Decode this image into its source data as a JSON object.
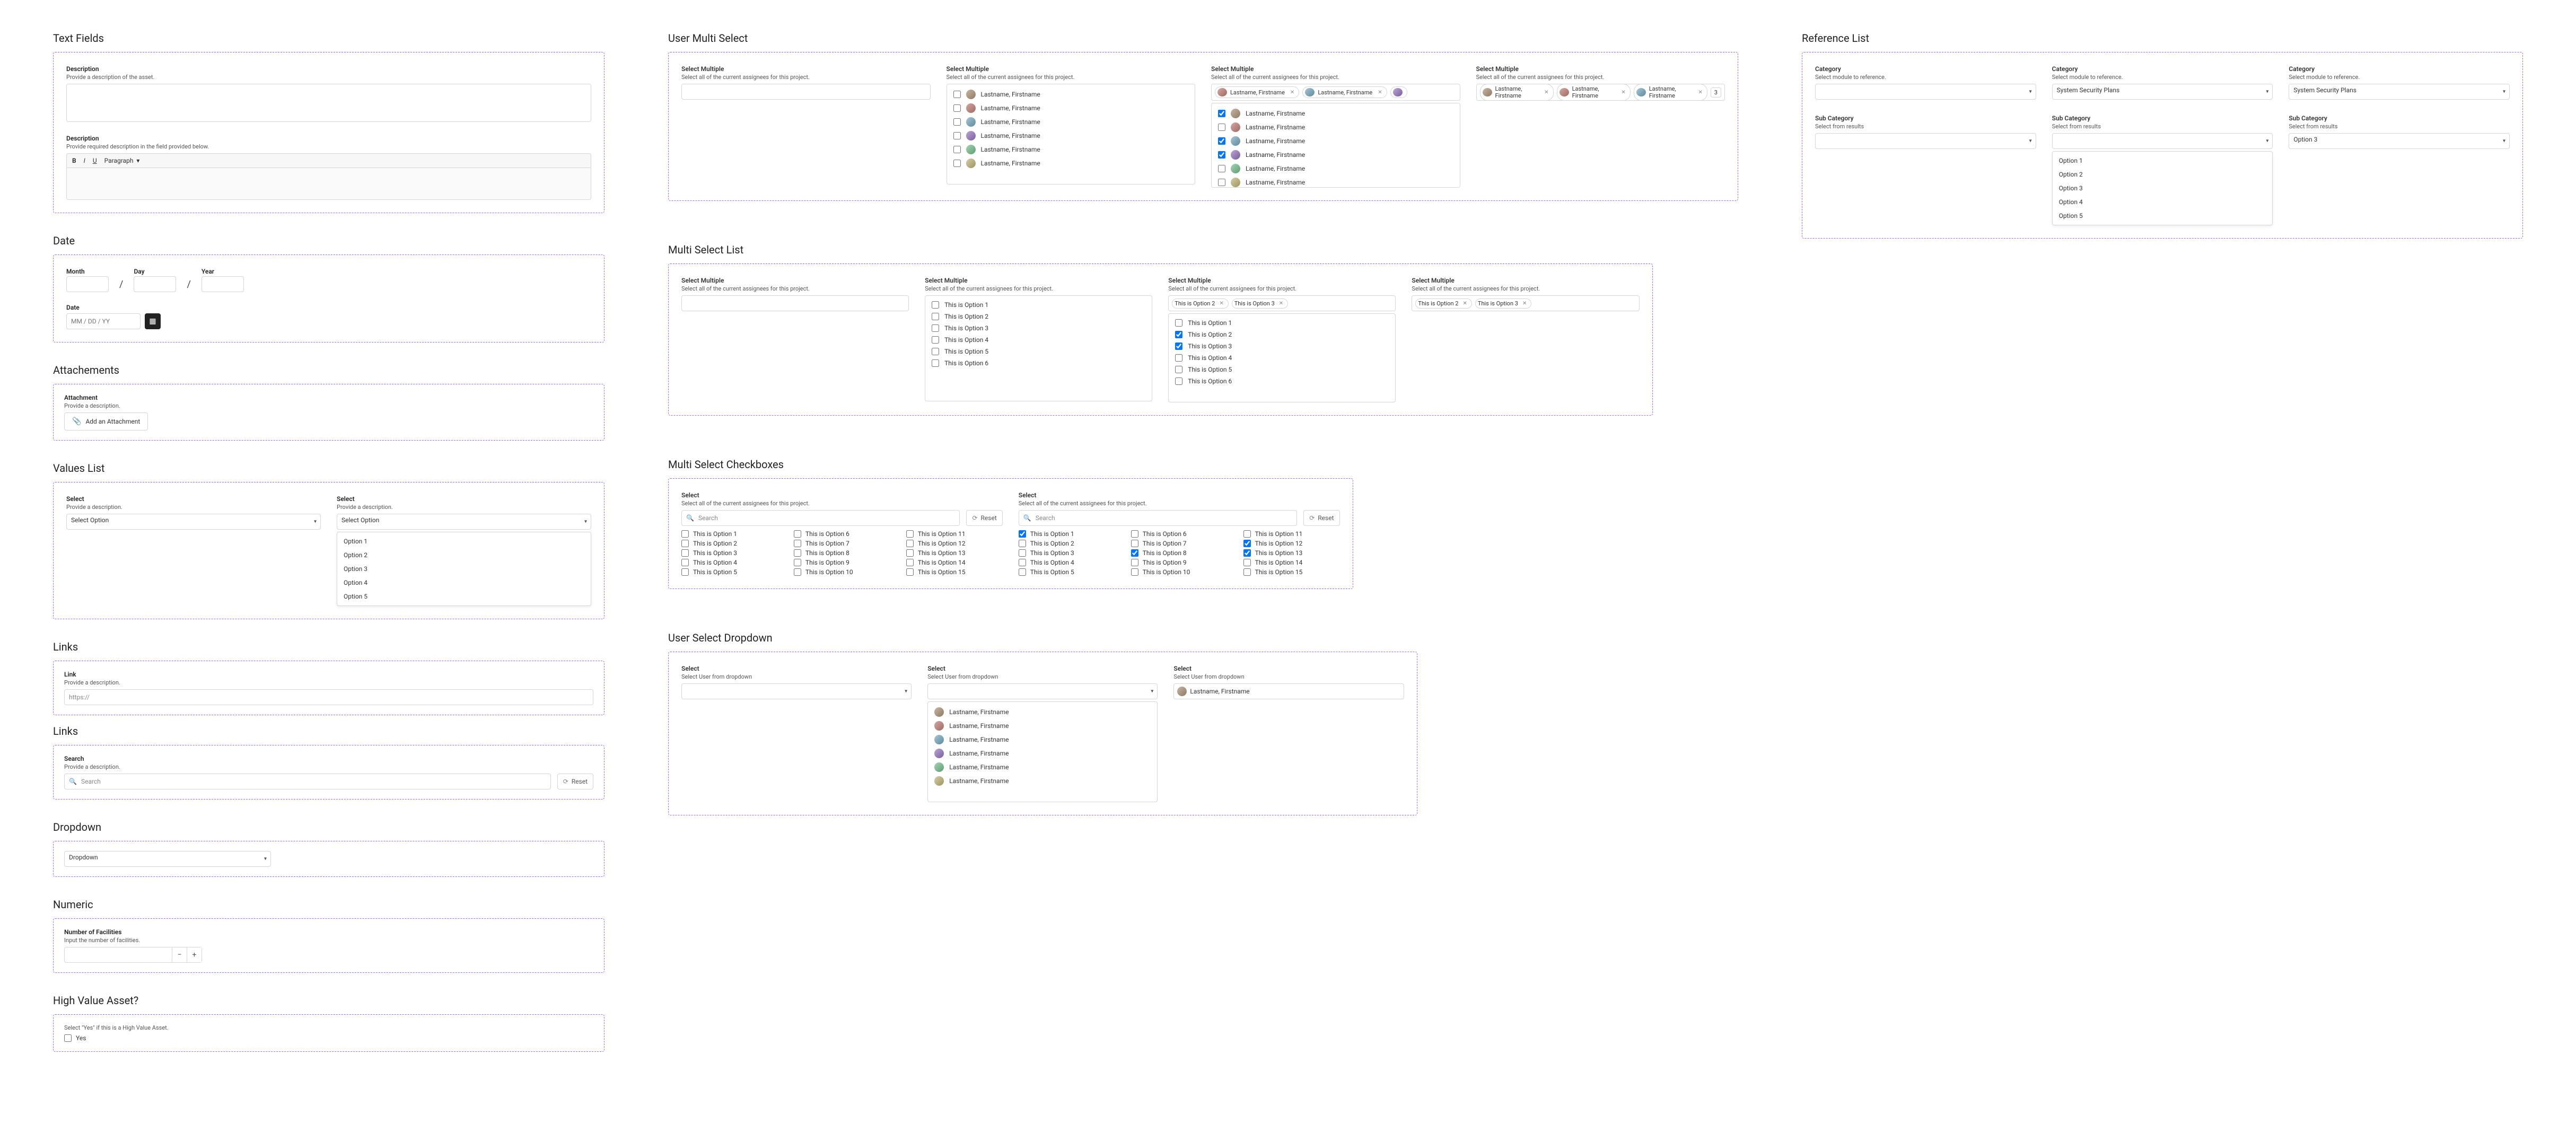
{
  "text_fields": {
    "section": "Text Fields",
    "desc1_label": "Description",
    "desc1_sub": "Provide a description of the asset.",
    "desc2_label": "Description",
    "desc2_sub": "Provide required description in the field provided below.",
    "rt_bold": "B",
    "rt_italic": "I",
    "rt_underline": "U",
    "rt_paragraph": "Paragraph"
  },
  "date": {
    "section": "Date",
    "month": "Month",
    "day": "Day",
    "year": "Year",
    "label2": "Date",
    "placeholder": "MM / DD / YY"
  },
  "attachments": {
    "section": "Attachements",
    "label": "Attachment",
    "sub": "Provide a description.",
    "btn": "Add an Attachment"
  },
  "values_list": {
    "section": "Values List",
    "select_label": "Select",
    "select_sub": "Provide a description.",
    "select_placeholder": "Select Option",
    "options": [
      "Option 1",
      "Option 2",
      "Option 3",
      "Option 4",
      "Option 5"
    ]
  },
  "links": {
    "section": "Links",
    "link_label": "Link",
    "link_sub": "Provide a description.",
    "link_placeholder": "https://",
    "sub_section": "Links",
    "search_label": "Search",
    "search_sub": "Provide a description.",
    "search_placeholder": "Search",
    "reset": "Reset"
  },
  "dropdown": {
    "section": "Dropdown",
    "placeholder": "Dropdown"
  },
  "numeric": {
    "section": "Numeric",
    "label": "Number of Facilities",
    "sub": "Input the number of facilities."
  },
  "hva": {
    "section": "High Value Asset?",
    "sub": "Select \"Yes\" if this is a High Value Asset.",
    "yes": "Yes"
  },
  "user_multi": {
    "section": "User Multi Select",
    "sub_label": "Select Multiple",
    "sub_desc": "Select all of the current assignees for this project.",
    "user": "Lastname, Firstname",
    "more": "3"
  },
  "multi_list": {
    "section": "Multi Select List",
    "options": [
      "This is Option 1",
      "This is Option 2",
      "This is Option 3",
      "This is Option 4",
      "This is Option 5",
      "This is Option 6"
    ],
    "chip2": "This is Option 2",
    "chip3": "This is Option 3"
  },
  "multi_cbx": {
    "section": "Multi Select Checkboxes",
    "select_label": "Select",
    "select_desc": "Select all of the current assignees for this project.",
    "search": "Search",
    "reset": "Reset",
    "opts": [
      "This is Option 1",
      "This is Option 2",
      "This is Option 3",
      "This is Option 4",
      "This is Option 5",
      "This is Option 6",
      "This is Option 7",
      "This is Option 8",
      "This is Option 9",
      "This is Option 10",
      "This is Option 11",
      "This is Option 12",
      "This is Option 13",
      "This is Option 14",
      "This is Option 15"
    ]
  },
  "user_select_dd": {
    "section": "User Select Dropdown",
    "label": "Select",
    "desc": "Select User from dropdown"
  },
  "reference_list": {
    "section": "Reference List",
    "cat_label": "Category",
    "cat_desc": "Select module to reference.",
    "cat_value": "System Security Plans",
    "sub_label": "Sub Category",
    "sub_desc": "Select from results",
    "sub_value": "Option 3",
    "popup": [
      "Option 1",
      "Option 2",
      "Option 3",
      "Option 4",
      "Option 5"
    ]
  }
}
